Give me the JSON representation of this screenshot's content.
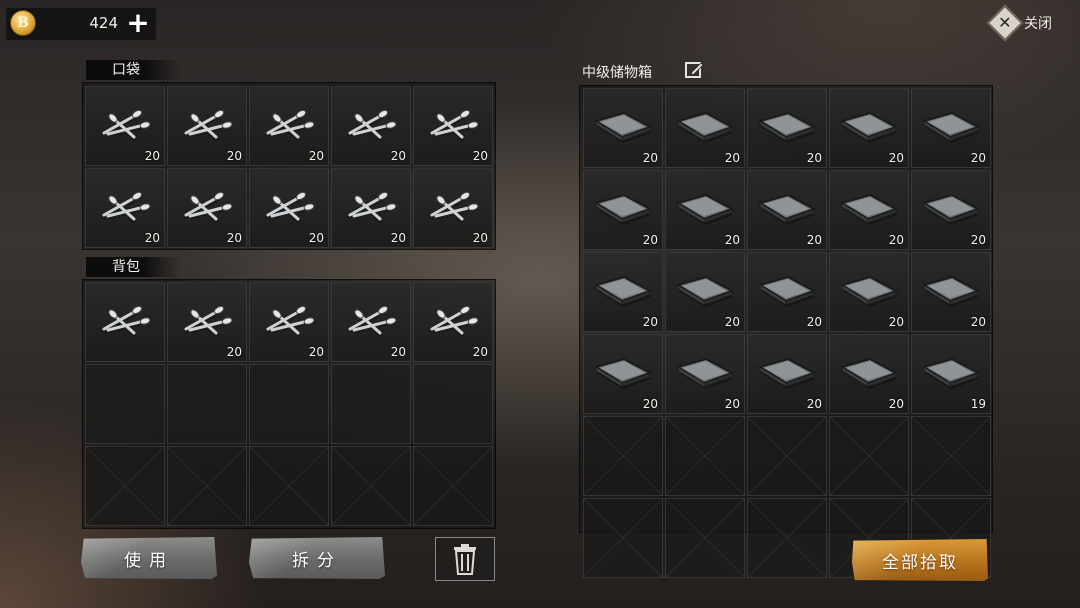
{
  "currency": {
    "icon": "coin-icon",
    "symbol": "B",
    "amount": "424",
    "add_symbol": "+"
  },
  "close": {
    "label": "关闭",
    "icon": "close-x-icon",
    "symbol": "✕"
  },
  "pocket": {
    "title": "口袋",
    "slots": [
      {
        "item": "nails",
        "qty": "20"
      },
      {
        "item": "nails",
        "qty": "20"
      },
      {
        "item": "nails",
        "qty": "20"
      },
      {
        "item": "nails",
        "qty": "20"
      },
      {
        "item": "nails",
        "qty": "20"
      },
      {
        "item": "nails",
        "qty": "20"
      },
      {
        "item": "nails",
        "qty": "20"
      },
      {
        "item": "nails",
        "qty": "20"
      },
      {
        "item": "nails",
        "qty": "20"
      },
      {
        "item": "nails",
        "qty": "20"
      }
    ]
  },
  "backpack": {
    "title": "背包",
    "slots": [
      {
        "item": "nails",
        "qty": ""
      },
      {
        "item": "nails",
        "qty": "20"
      },
      {
        "item": "nails",
        "qty": "20"
      },
      {
        "item": "nails",
        "qty": "20"
      },
      {
        "item": "nails",
        "qty": "20"
      },
      {
        "item": "empty"
      },
      {
        "item": "empty"
      },
      {
        "item": "empty"
      },
      {
        "item": "empty"
      },
      {
        "item": "empty"
      },
      {
        "item": "locked"
      },
      {
        "item": "locked"
      },
      {
        "item": "locked"
      },
      {
        "item": "locked"
      },
      {
        "item": "locked"
      }
    ]
  },
  "storage": {
    "title": "中级储物箱",
    "edit_icon": "edit-icon",
    "slots": [
      {
        "item": "metal-plate",
        "qty": "20"
      },
      {
        "item": "metal-plate",
        "qty": "20"
      },
      {
        "item": "metal-plate",
        "qty": "20"
      },
      {
        "item": "metal-plate",
        "qty": "20"
      },
      {
        "item": "metal-plate",
        "qty": "20"
      },
      {
        "item": "metal-plate",
        "qty": "20"
      },
      {
        "item": "metal-plate",
        "qty": "20"
      },
      {
        "item": "metal-plate",
        "qty": "20"
      },
      {
        "item": "metal-plate",
        "qty": "20"
      },
      {
        "item": "metal-plate",
        "qty": "20"
      },
      {
        "item": "metal-plate",
        "qty": "20"
      },
      {
        "item": "metal-plate",
        "qty": "20"
      },
      {
        "item": "metal-plate",
        "qty": "20"
      },
      {
        "item": "metal-plate",
        "qty": "20"
      },
      {
        "item": "metal-plate",
        "qty": "20"
      },
      {
        "item": "metal-plate",
        "qty": "20"
      },
      {
        "item": "metal-plate",
        "qty": "20"
      },
      {
        "item": "metal-plate",
        "qty": "20"
      },
      {
        "item": "metal-plate",
        "qty": "20"
      },
      {
        "item": "metal-plate",
        "qty": "19"
      },
      {
        "item": "locked"
      },
      {
        "item": "locked"
      },
      {
        "item": "locked"
      },
      {
        "item": "locked"
      },
      {
        "item": "locked"
      },
      {
        "item": "locked"
      },
      {
        "item": "locked"
      },
      {
        "item": "locked"
      },
      {
        "item": "locked"
      },
      {
        "item": "locked"
      }
    ]
  },
  "actions": {
    "use_label": "使用",
    "split_label": "拆分",
    "trash_icon": "trash-icon",
    "take_all_label": "全部拾取"
  },
  "colors": {
    "accent_gold": "#b8731c",
    "stone": "#7a7a78"
  }
}
